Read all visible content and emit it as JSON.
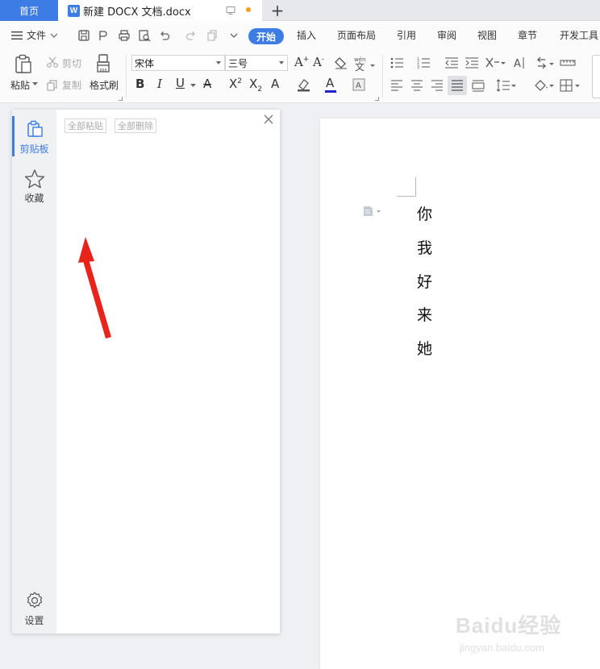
{
  "tabs": {
    "home": "首页",
    "document": "新建 DOCX 文档.docx",
    "doc_logo": "W",
    "add": "+"
  },
  "menu": {
    "file": "文件",
    "items": [
      "开始",
      "插入",
      "页面布局",
      "引用",
      "审阅",
      "视图",
      "章节",
      "开发工具"
    ]
  },
  "ribbon": {
    "paste": "粘贴",
    "cut": "剪切",
    "copy": "复制",
    "format_painter": "格式刷",
    "font_name": "宋体",
    "font_size": "三号"
  },
  "clipboard_pane": {
    "paste_all": "全部粘贴",
    "delete_all": "全部删除",
    "side_items": [
      "剪贴板",
      "收藏"
    ],
    "settings": "设置"
  },
  "document": {
    "lines": [
      "你",
      "我",
      "好",
      "来",
      "她"
    ]
  },
  "watermark": {
    "main": "Baidu经验",
    "sub": "jingyan.baidu.com"
  },
  "colors": {
    "accent": "#3d7ce5",
    "arrow": "#e8231b",
    "unsaved_dot": "#f0a020"
  }
}
